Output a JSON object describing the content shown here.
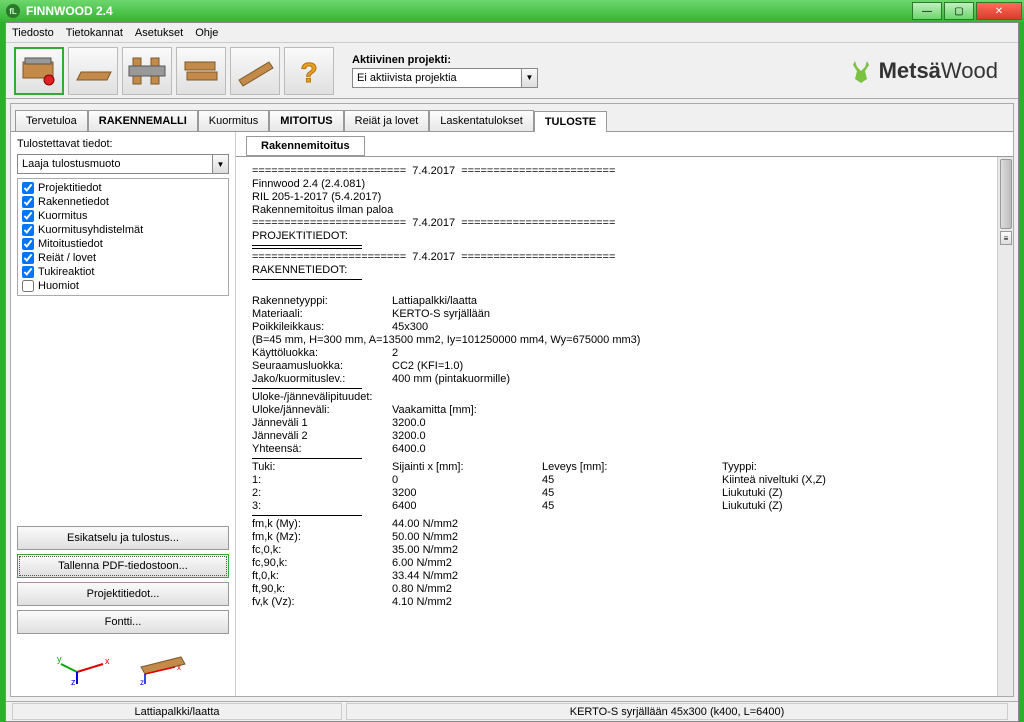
{
  "title": "FINNWOOD 2.4",
  "menu": [
    "Tiedosto",
    "Tietokannat",
    "Asetukset",
    "Ohje"
  ],
  "project": {
    "label": "Aktiivinen projekti:",
    "value": "Ei aktiivista projektia"
  },
  "logo": {
    "brand": "Metsä",
    "suffix": "Wood"
  },
  "main_tabs": [
    {
      "label": "Tervetuloa",
      "bold": false
    },
    {
      "label": "RAKENNEMALLI",
      "bold": true
    },
    {
      "label": "Kuormitus",
      "bold": false
    },
    {
      "label": "MITOITUS",
      "bold": true
    },
    {
      "label": "Reiät ja lovet",
      "bold": false
    },
    {
      "label": "Laskentatulokset",
      "bold": false
    },
    {
      "label": "TULOSTE",
      "bold": true,
      "active": true
    }
  ],
  "sidebar": {
    "print_label": "Tulostettavat tiedot:",
    "format_value": "Laaja tulostusmuoto",
    "checks": [
      {
        "label": "Projektitiedot",
        "checked": true
      },
      {
        "label": "Rakennetiedot",
        "checked": true
      },
      {
        "label": "Kuormitus",
        "checked": true
      },
      {
        "label": "Kuormitusyhdistelmät",
        "checked": true
      },
      {
        "label": "Mitoitustiedot",
        "checked": true
      },
      {
        "label": "Reiät / lovet",
        "checked": true
      },
      {
        "label": "Tukireaktiot",
        "checked": true
      },
      {
        "label": "Huomiot",
        "checked": false
      }
    ],
    "buttons": {
      "preview": "Esikatselu ja tulostus...",
      "save_pdf": "Tallenna PDF-tiedostoon...",
      "project_info": "Projektitiedot...",
      "font": "Fontti..."
    }
  },
  "sub_tab": "Rakennemitoitus",
  "report": {
    "divider_date": "========================  7.4.2017  ========================",
    "app_version": "Finnwood 2.4 (2.4.081)",
    "ril": "RIL 205-1-2017 (5.4.2017)",
    "calc_type": "Rakennemitoitus ilman paloa",
    "section_project": "PROJEKTITIEDOT:",
    "section_structure": "RAKENNETIEDOT:",
    "structure": {
      "type_label": "Rakennetyyppi:",
      "type_val": "Lattiapalkki/laatta",
      "material_label": "Materiaali:",
      "material_val": "KERTO-S syrjällään",
      "cross_label": "Poikkileikkaus:",
      "cross_val": "45x300",
      "cross_detail": "(B=45 mm, H=300 mm, A=13500 mm2, Iy=101250000 mm4, Wy=675000 mm3)",
      "service_label": "Käyttöluokka:",
      "service_val": "2",
      "conseq_label": "Seuraamusluokka:",
      "conseq_val": "CC2 (KFI=1.0)",
      "spacing_label": "Jako/kuormituslev.:",
      "spacing_val": "400 mm (pintakuormille)"
    },
    "spans": {
      "header": "Uloke-/jännevälipituudet:",
      "col1": "Uloke/jänneväli:",
      "col2": "Vaakamitta [mm]:",
      "rows": [
        {
          "a": "Jänneväli 1",
          "b": "3200.0"
        },
        {
          "a": "Jänneväli 2",
          "b": "3200.0"
        },
        {
          "a": "Yhteensä:",
          "b": "6400.0"
        }
      ]
    },
    "supports": {
      "h1": "Tuki:",
      "h2": "Sijainti x [mm]:",
      "h3": "Leveys [mm]:",
      "h4": "Tyyppi:",
      "rows": [
        {
          "a": "1:",
          "b": "0",
          "c": "45",
          "d": "Kiinteä niveltuki (X,Z)"
        },
        {
          "a": "2:",
          "b": "3200",
          "c": "45",
          "d": "Liukutuki (Z)"
        },
        {
          "a": "3:",
          "b": "6400",
          "c": "45",
          "d": "Liukutuki (Z)"
        }
      ]
    },
    "props": [
      {
        "a": "fm,k (My):",
        "b": "44.00 N/mm2"
      },
      {
        "a": "fm,k (Mz):",
        "b": "50.00 N/mm2"
      },
      {
        "a": "fc,0,k:",
        "b": "35.00 N/mm2"
      },
      {
        "a": "fc,90,k:",
        "b": "6.00 N/mm2"
      },
      {
        "a": "ft,0,k:",
        "b": "33.44 N/mm2"
      },
      {
        "a": "ft,90,k:",
        "b": "0.80 N/mm2"
      },
      {
        "a": "fv,k (Vz):",
        "b": "4.10 N/mm2"
      }
    ]
  },
  "status": {
    "left": "Lattiapalkki/laatta",
    "center": "KERTO-S syrjällään 45x300 (k400, L=6400)"
  }
}
